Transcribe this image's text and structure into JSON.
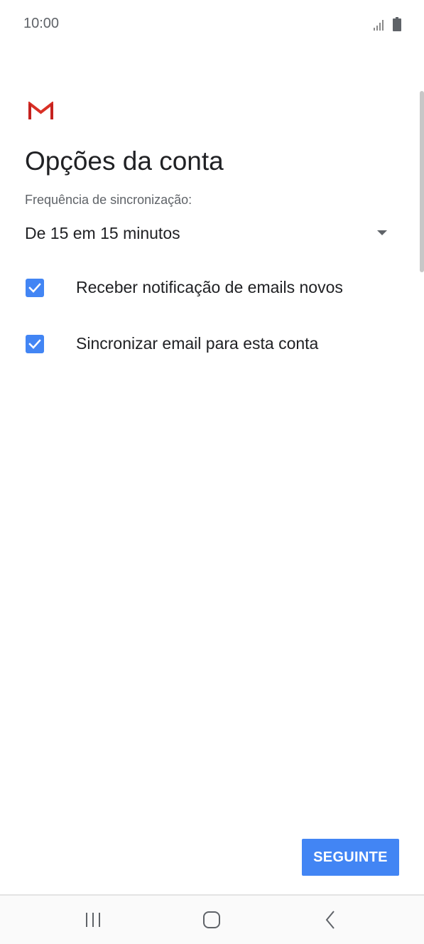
{
  "status_bar": {
    "time": "10:00",
    "icons": [
      "signal-icon",
      "battery-icon"
    ]
  },
  "app": {
    "logo": "gmail-icon",
    "colors": {
      "accent": "#4285f4",
      "logo_red": "#d93025"
    }
  },
  "page": {
    "title": "Opções da conta",
    "sync_label": "Frequência de sincronização:",
    "sync_value": "De 15 em 15 minutos",
    "options": [
      {
        "label": "Receber notificação de emails novos",
        "checked": true
      },
      {
        "label": "Sincronizar email para esta conta",
        "checked": true
      }
    ],
    "next_button": "SEGUINTE"
  },
  "nav_bar": {
    "buttons": [
      "recents-icon",
      "home-icon",
      "back-icon"
    ]
  }
}
